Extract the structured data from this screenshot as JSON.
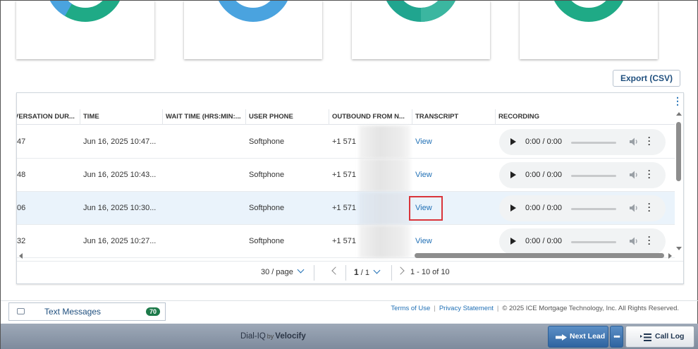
{
  "donuts": [
    {
      "primary": "#1faa86",
      "secondary": "#4aa3df"
    },
    {
      "primary": "#4aa3df",
      "secondary": "#4aa3df"
    },
    {
      "primary": "#20a58f",
      "secondary": "#3bb6a0"
    },
    {
      "primary": "#1faa86",
      "secondary": "#1faa86"
    }
  ],
  "toolbar": {
    "export_label": "Export (CSV)"
  },
  "table": {
    "columns": [
      "VERSATION DUR...",
      "TIME",
      "WAIT TIME (HRS:MIN:...",
      "USER PHONE",
      "OUTBOUND FROM N...",
      "TRANSCRIPT",
      "RECORDING"
    ],
    "rows": [
      {
        "duration": "47",
        "time": "Jun 16, 2025 10:47...",
        "wait": "",
        "user_phone": "Softphone",
        "outbound": "+1 571",
        "transcript": "View",
        "recording": "0:00 / 0:00"
      },
      {
        "duration": "48",
        "time": "Jun 16, 2025 10:43...",
        "wait": "",
        "user_phone": "Softphone",
        "outbound": "+1 571",
        "transcript": "View",
        "recording": "0:00 / 0:00"
      },
      {
        "duration": "06",
        "time": "Jun 16, 2025 10:30...",
        "wait": "",
        "user_phone": "Softphone",
        "outbound": "+1 571",
        "transcript": "View",
        "recording": "0:00 / 0:00"
      },
      {
        "duration": "32",
        "time": "Jun 16, 2025 10:27...",
        "wait": "",
        "user_phone": "Softphone",
        "outbound": "+1 571",
        "transcript": "View",
        "recording": "0:00 / 0:00"
      }
    ]
  },
  "pagination": {
    "page_size": "30 / page",
    "current_page": "1",
    "total_pages": "/ 1",
    "range": "1 - 10 of 10"
  },
  "text_messages": {
    "label": "Text Messages",
    "count": "70"
  },
  "footer": {
    "terms": "Terms of Use",
    "privacy": "Privacy Statement",
    "copyright": "© 2025 ICE Mortgage Technology, Inc. All Rights Reserved."
  },
  "bottom_bar": {
    "brand_dial": "Dial-IQ",
    "brand_by": "by",
    "brand_velocify": "Velocify",
    "next_lead": "Next Lead",
    "more": "•••",
    "call_log": "Call Log"
  },
  "colors": {
    "accent": "#1f6fb5",
    "highlight_row": "#eaf3fb",
    "highlight_box": "#d9343a",
    "badge": "#1d7a4a"
  }
}
